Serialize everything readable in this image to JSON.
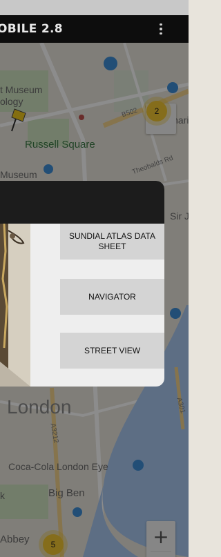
{
  "app": {
    "title": "OBILE 2.8",
    "menu_icon": "more-vert-icon"
  },
  "map": {
    "labels": {
      "museum_1": "t Museum",
      "museum_2": "ology",
      "russell_square": "Russell Square",
      "museum_3": "Museum",
      "theobalds": "Theobalds Rd",
      "b502": "B502",
      "charing": "Chari",
      "sir": "Sir J",
      "london": "London",
      "a3212": "A3212",
      "a301": "A301",
      "eye": "Coca-Cola London Eye",
      "big_ben": "Big Ben",
      "abbey": "Abbey",
      "left_k": "k"
    },
    "clusters": {
      "c1": "2",
      "c2": "5"
    },
    "zoom": {
      "in": "+",
      "out": "−"
    }
  },
  "dialog": {
    "buttons": {
      "atlas": "SUNDIAL ATLAS DATA SHEET",
      "navigator": "NAVIGATOR",
      "street_view": "STREET VIEW"
    }
  }
}
